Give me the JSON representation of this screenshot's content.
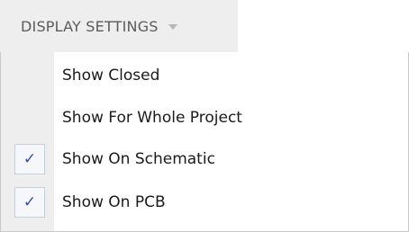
{
  "dropdown": {
    "label": "DISPLAY SETTINGS",
    "caret_icon": "caret-down-icon"
  },
  "menu": {
    "items": [
      {
        "label": "Show Closed",
        "checked": false
      },
      {
        "label": "Show For Whole Project",
        "checked": false
      },
      {
        "label": "Show On Schematic",
        "checked": true,
        "check_glyph": "✓"
      },
      {
        "label": "Show On PCB",
        "checked": true,
        "check_glyph": "✓"
      }
    ]
  },
  "colors": {
    "accent_check": "#2b4fae",
    "gutter_background": "#eeeeee",
    "menu_border": "#c8c8c8"
  }
}
